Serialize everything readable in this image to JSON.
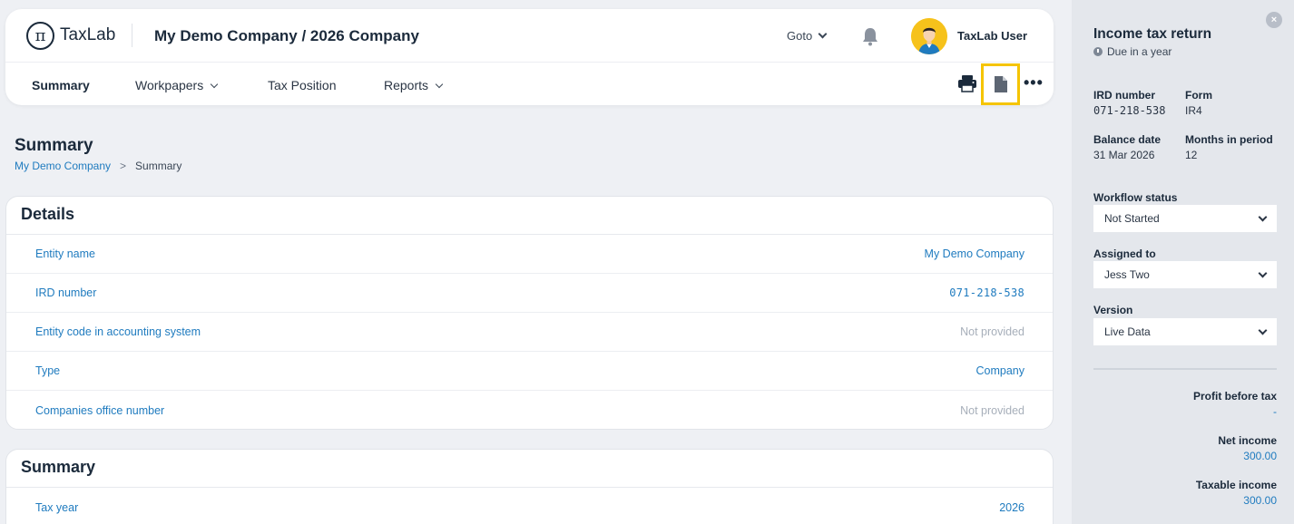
{
  "app": {
    "logo_text": "TaxLab",
    "logo_glyph": "π"
  },
  "header": {
    "company_title": "My Demo Company / 2026 Company",
    "goto_label": "Goto",
    "user_name": "TaxLab User"
  },
  "nav": {
    "items": [
      {
        "label": "Summary"
      },
      {
        "label": "Workpapers"
      },
      {
        "label": "Tax Position"
      },
      {
        "label": "Reports"
      }
    ],
    "more_glyph": "•••"
  },
  "page": {
    "title": "Summary",
    "breadcrumb": {
      "link": "My Demo Company",
      "separator": ">",
      "current": "Summary"
    }
  },
  "details": {
    "title": "Details",
    "rows": [
      {
        "label": "Entity name",
        "value": "My Demo Company"
      },
      {
        "label": "IRD number",
        "value": "071-218-538"
      },
      {
        "label": "Entity code in accounting system",
        "value": "Not provided"
      },
      {
        "label": "Type",
        "value": "Company"
      },
      {
        "label": "Companies office number",
        "value": "Not provided"
      }
    ]
  },
  "summary_card": {
    "title": "Summary",
    "rows": [
      {
        "label": "Tax year",
        "value": "2026"
      }
    ]
  },
  "panel": {
    "close_glyph": "×",
    "title": "Income tax return",
    "due": "Due in a year",
    "ird_label": "IRD number",
    "ird_value": "071-218-538",
    "form_label": "Form",
    "form_value": "IR4",
    "balance_label": "Balance date",
    "balance_value": "31 Mar 2026",
    "months_label": "Months in period",
    "months_value": "12",
    "workflow_label": "Workflow status",
    "workflow_value": "Not Started",
    "assigned_label": "Assigned to",
    "assigned_value": "Jess Two",
    "version_label": "Version",
    "version_value": "Live Data",
    "profit_label": "Profit before tax",
    "profit_value": "-",
    "net_label": "Net income",
    "net_value": "300.00",
    "taxable_label": "Taxable income",
    "taxable_value": "300.00"
  },
  "colors": {
    "accent": "#1f7bbf",
    "highlight": "#f5c400",
    "avatar": "#f6c21b"
  }
}
